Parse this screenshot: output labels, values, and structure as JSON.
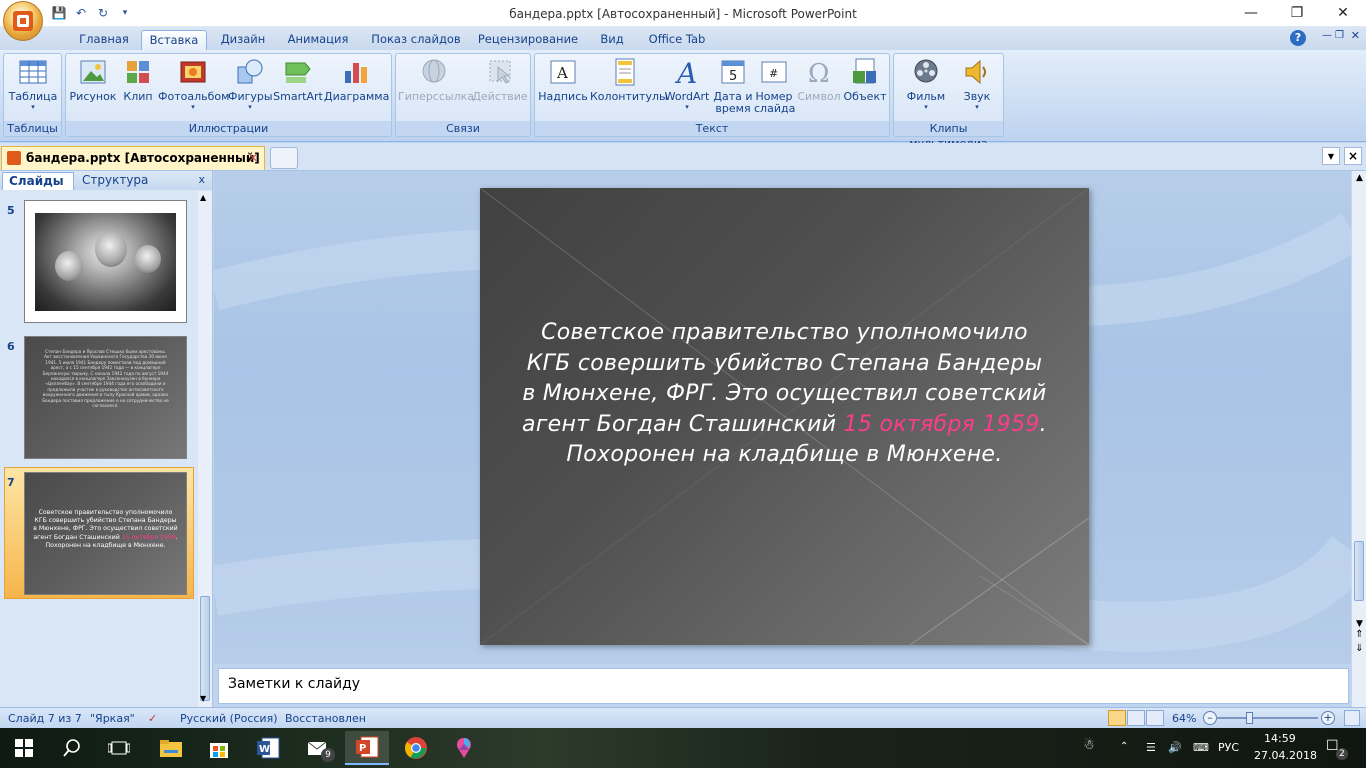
{
  "window": {
    "title": "бандера.pptx [Автосохраненный] - Microsoft PowerPoint",
    "controls": [
      "—",
      "❐",
      "✕"
    ]
  },
  "ribbon_tabs": [
    {
      "label": "Главная",
      "active": false
    },
    {
      "label": "Вставка",
      "active": true
    },
    {
      "label": "Дизайн",
      "active": false
    },
    {
      "label": "Анимация",
      "active": false
    },
    {
      "label": "Показ слайдов",
      "active": false
    },
    {
      "label": "Рецензирование",
      "active": false
    },
    {
      "label": "Вид",
      "active": false
    },
    {
      "label": "Office Tab",
      "active": false
    }
  ],
  "ribbon": {
    "groups": {
      "tables": "Таблицы",
      "illustrations": "Иллюстрации",
      "links": "Связи",
      "text": "Текст",
      "media": "Клипы мультимедиа"
    },
    "buttons": {
      "table": "Таблица",
      "picture": "Рисунок",
      "clip": "Клип",
      "photo_album": "Фотоальбом",
      "shapes": "Фигуры",
      "smartart": "SmartArt",
      "chart": "Диаграмма",
      "hyperlink": "Гиперссылка",
      "action": "Действие",
      "textbox": "Надпись",
      "header_footer": "Колонтитулы",
      "wordart": "WordArt",
      "datetime_1": "Дата и",
      "datetime_2": "время",
      "slide_num_1": "Номер",
      "slide_num_2": "слайда",
      "symbol": "Символ",
      "object": "Объект",
      "movie": "Фильм",
      "sound": "Звук"
    }
  },
  "doc_tab": {
    "label": "бандера.pptx [Автосохраненный]",
    "close": "✕"
  },
  "left_pane": {
    "tab_slides": "Слайды",
    "tab_outline": "Структура",
    "close": "x",
    "slide_numbers": [
      "5",
      "6",
      "7"
    ],
    "thumb6_text": "Степан Бандера и Ярослав Стецько были арестованы. Акт восстановления Украинского Государства 30 июня 1941. 5 июля 1941 Бандеру поместили под домашний арест, а с 15 сентября 1941 года — в концлагере Берлинскую тюрьму. С начала 1942 года по август 1944 находился в концлагере Заксенхаузен в бункере «Целленбау». В сентябре 1944 года его освободили и предложили участие в руководстве антисоветского вооруженного движения в тылу Красной армии, однако Бандера поставил предложение о на сотрудничество не согласился.",
    "thumb7_pre": "Советское правительство уполномочило КГБ совершить убийство Степана Бандеры в Мюнхене, ФРГ. Это осуществил советский агент Богдан Сташинский ",
    "thumb7_date": "15 октября 1959",
    "thumb7_post": ". Похоронен на кладбище в Мюнхене."
  },
  "slide": {
    "text_pre": "Советское правительство уполномочило КГБ совершить убийство Степана Бандеры в Мюнхене, ФРГ. Это осуществил советский агент Богдан Сташинский ",
    "text_date": "15 октября 1959",
    "text_post": ". Похоронен на кладбище в Мюнхене.",
    "date_color": "#ff3c8a"
  },
  "notes_placeholder": "Заметки к слайду",
  "status": {
    "slide_info": "Слайд 7 из 7",
    "theme": "\"Яркая\"",
    "language": "Русский (Россия)",
    "state": "Восстановлен",
    "zoom": "64%"
  },
  "taskbar": {
    "mail_badge": "9",
    "language": "РУС",
    "time": "14:59",
    "date": "27.04.2018",
    "notifications": "2"
  }
}
